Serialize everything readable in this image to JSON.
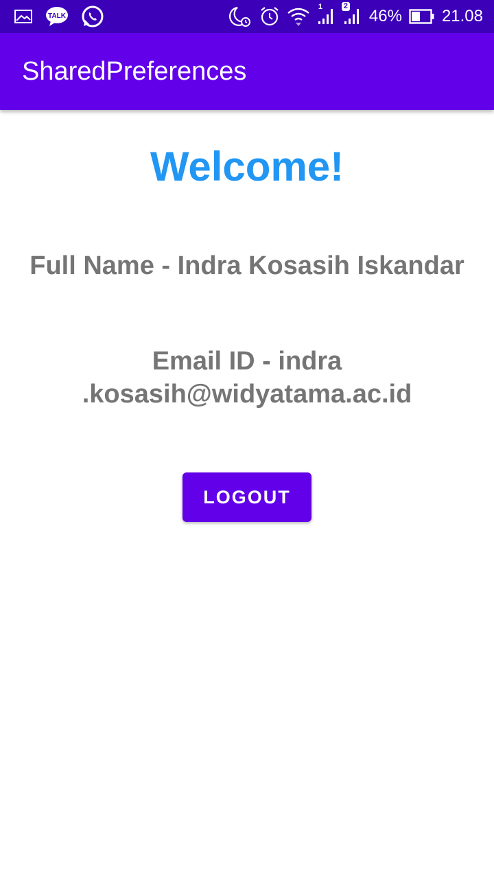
{
  "status_bar": {
    "left_icons": [
      "gallery-icon",
      "kakaotalk-icon",
      "whatsapp-icon"
    ],
    "kakaotalk_label": "TALK",
    "sim1_label": "1",
    "sim2_label": "2",
    "battery_percent": "46%",
    "time": "21.08",
    "background": "#3c00b9"
  },
  "app_bar": {
    "title": "SharedPreferences",
    "background": "#6200ea"
  },
  "main": {
    "welcome": "Welcome!",
    "full_name": "Full Name - Indra Kosasih Iskandar",
    "email": "Email ID - indra .kosasih@widyatama.ac.id",
    "logout_label": "LOGOUT"
  },
  "colors": {
    "accent": "#2196f3",
    "primary": "#6200ea",
    "text_secondary": "#757575"
  }
}
